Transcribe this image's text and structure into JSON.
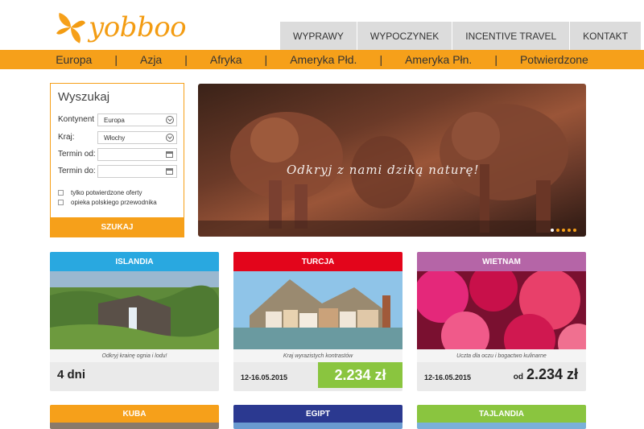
{
  "logo": {
    "text": "yobboo",
    "icon": "pinwheel-logo-icon"
  },
  "topnav": [
    "WYPRAWY",
    "WYPOCZYNEK",
    "INCENTIVE TRAVEL",
    "KONTAKT"
  ],
  "categories": [
    "Europa",
    "Azja",
    "Afryka",
    "Ameryka Płd.",
    "Ameryka Płn.",
    "Potwierdzone"
  ],
  "category_separator": "|",
  "search": {
    "title": "Wyszukaj",
    "kontynent_label": "Kontynent",
    "kontynent_value": "Europa",
    "kraj_label": "Kraj:",
    "kraj_value": "Włochy",
    "termin_od_label": "Termin od:",
    "termin_do_label": "Termin do:",
    "check1": "tylko potwierdzone oferty",
    "check2": "opieka polskiego przewodnika",
    "button": "SZUKAJ"
  },
  "hero": {
    "tagline": "Odkryj z nami dziką naturę!"
  },
  "cards": [
    {
      "title": "ISLANDIA",
      "color": "#29a8e0",
      "subtitle": "Odkryj krainę ognia i lodu!",
      "days": "4 dni"
    },
    {
      "title": "TURCJA",
      "color": "#e3051b",
      "subtitle": "Kraj wyrazistych kontrastów",
      "date": "12-16.05.2015",
      "price": "2.234 zł"
    },
    {
      "title": "WIETNAM",
      "color": "#b565a7",
      "subtitle": "Uczta dla oczu i bogactwo kulinarne",
      "date": "12-16.05.2015",
      "from": "od",
      "price": "2.234 zł"
    }
  ],
  "bottom_cards": [
    {
      "title": "KUBA",
      "color": "#f6a01a"
    },
    {
      "title": "EGIPT",
      "color": "#2b3990"
    },
    {
      "title": "TAJLANDIA",
      "color": "#8ac53f"
    }
  ],
  "colors": {
    "accent": "#f6a01a",
    "price_green": "#8ac53f"
  }
}
